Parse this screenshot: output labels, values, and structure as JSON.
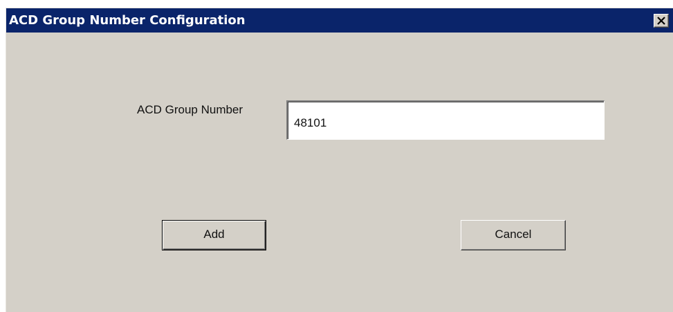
{
  "window": {
    "title": "ACD Group Number Configuration",
    "close_icon": "close-icon"
  },
  "form": {
    "acd_group_number_label": "ACD Group Number",
    "acd_group_number_value": "48101"
  },
  "buttons": {
    "add_label": "Add",
    "cancel_label": "Cancel"
  },
  "colors": {
    "titlebar": "#0a246a",
    "dialog_background": "#d4d0c8",
    "title_text": "#ffffff"
  }
}
